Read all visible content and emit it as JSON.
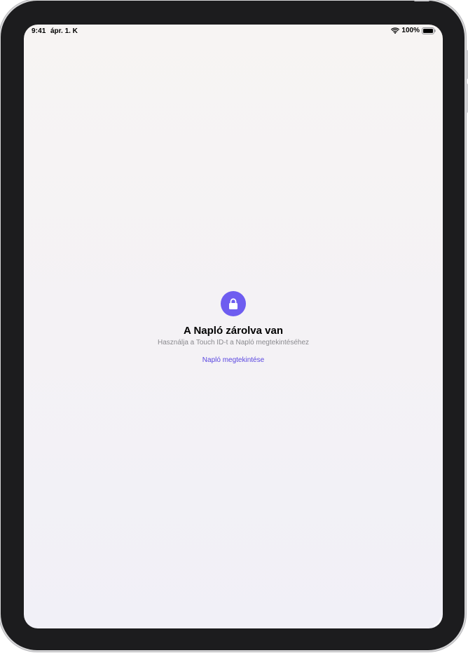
{
  "status_bar": {
    "time": "9:41",
    "date": "ápr. 1. K",
    "battery": "100%",
    "icons": [
      "wifi-icon",
      "battery-icon"
    ]
  },
  "lock_screen": {
    "icon": "lock-icon",
    "title": "A Napló zárolva van",
    "subtitle": "Használja a Touch ID-t a Napló megtekintéséhez",
    "action_label": "Napló megtekintése"
  },
  "colors": {
    "accent": "#6e5df0",
    "link": "#5a47e0",
    "subtitle": "#8a8a8e",
    "device_frame": "#1c1c1e"
  }
}
